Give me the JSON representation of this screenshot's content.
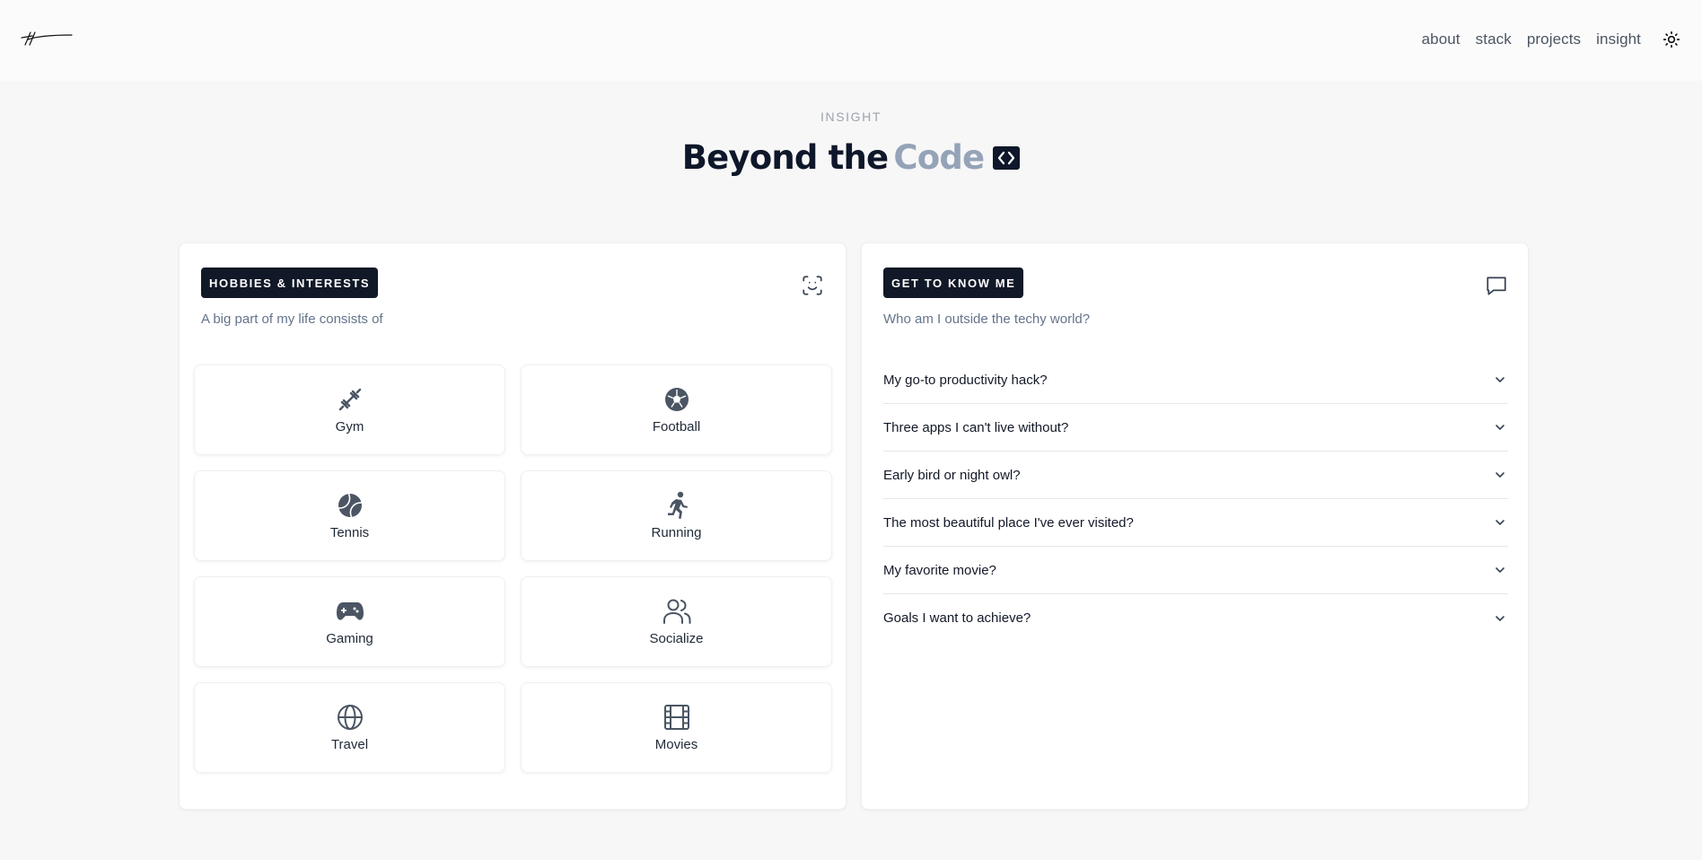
{
  "header": {
    "logo_icon": "signature-logo",
    "nav": [
      "about",
      "stack",
      "projects",
      "insight"
    ],
    "theme_toggle_icon": "sun-icon"
  },
  "hero": {
    "eyebrow": "INSIGHT",
    "title_main": "Beyond the",
    "title_accent": "Code",
    "title_icon": "code-icon"
  },
  "hobbies": {
    "badge": "HOBBIES & INTERESTS",
    "subtitle": "A big part of my life consists of",
    "corner_icon": "scan-face-icon",
    "items": [
      {
        "label": "Gym",
        "icon": "dumbbell-icon"
      },
      {
        "label": "Football",
        "icon": "football-icon"
      },
      {
        "label": "Tennis",
        "icon": "tennis-ball-icon"
      },
      {
        "label": "Running",
        "icon": "runner-icon"
      },
      {
        "label": "Gaming",
        "icon": "gamepad-icon"
      },
      {
        "label": "Socialize",
        "icon": "users-icon"
      },
      {
        "label": "Travel",
        "icon": "globe-icon"
      },
      {
        "label": "Movies",
        "icon": "film-icon"
      }
    ]
  },
  "about": {
    "badge": "GET TO KNOW ME",
    "subtitle": "Who am I outside the techy world?",
    "corner_icon": "chat-icon",
    "questions": [
      "My go-to productivity hack?",
      "Three apps I can't live without?",
      "Early bird or night owl?",
      "The most beautiful place I've ever visited?",
      "My favorite movie?",
      "Goals I want to achieve?"
    ]
  }
}
